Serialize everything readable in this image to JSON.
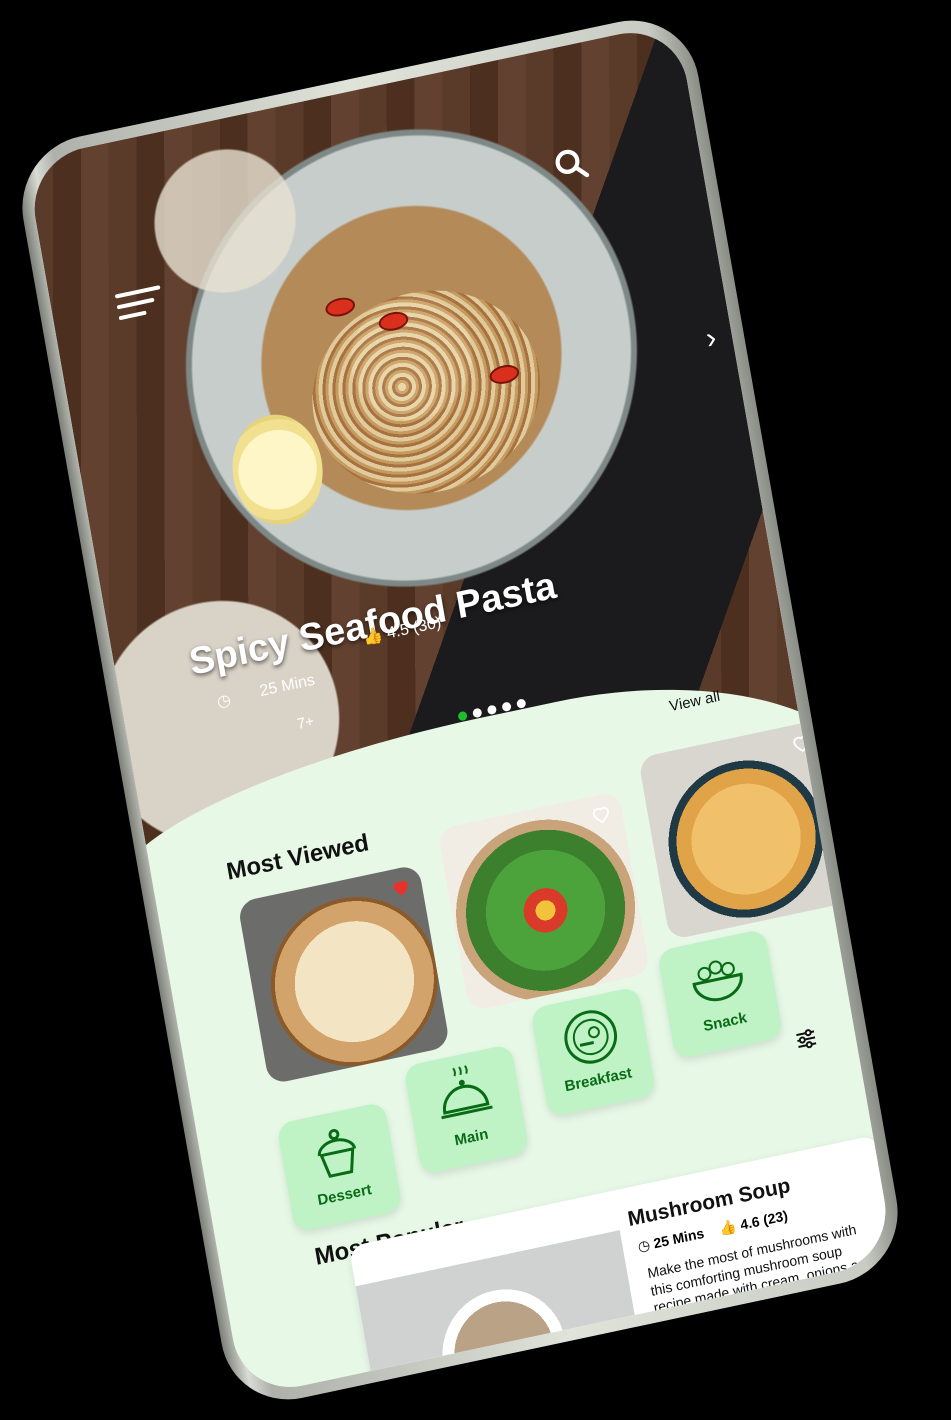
{
  "hero": {
    "title": "Spicy Seafood Pasta",
    "time": "25 Mins",
    "rating": "4.5 (30)",
    "ingredients_more": "7+",
    "carousel_count": 5,
    "carousel_active": 1
  },
  "most_viewed": {
    "title": "Most Viewed",
    "view_all": "View all",
    "cards": [
      {
        "dish": "pie",
        "favorited": true
      },
      {
        "dish": "salad",
        "favorited": false
      },
      {
        "dish": "risotto",
        "favorited": false
      }
    ]
  },
  "categories": [
    {
      "label": "Dessert",
      "icon": "cupcake-icon"
    },
    {
      "label": "Main",
      "icon": "cloche-icon"
    },
    {
      "label": "Breakfast",
      "icon": "plate-egg-icon"
    },
    {
      "label": "Snack",
      "icon": "bowl-icon"
    }
  ],
  "most_popular": {
    "title": "Most Popular",
    "card": {
      "title": "Mushroom Soup",
      "time": "25 Mins",
      "rating": "4.6 (23)",
      "description": "Make the most of mushrooms with this comforting mushroom soup recipe made with cream, onions and garlic."
    }
  },
  "nav": {
    "items": [
      "info-icon",
      "cart-icon",
      "home-icon",
      "heart-icon",
      "profile-icon"
    ],
    "active": "home-icon"
  },
  "colors": {
    "accent": "#0a6b17",
    "background": "#e7f8e7",
    "category_tile": "#bff3c5",
    "favorite": "#e8322a"
  }
}
